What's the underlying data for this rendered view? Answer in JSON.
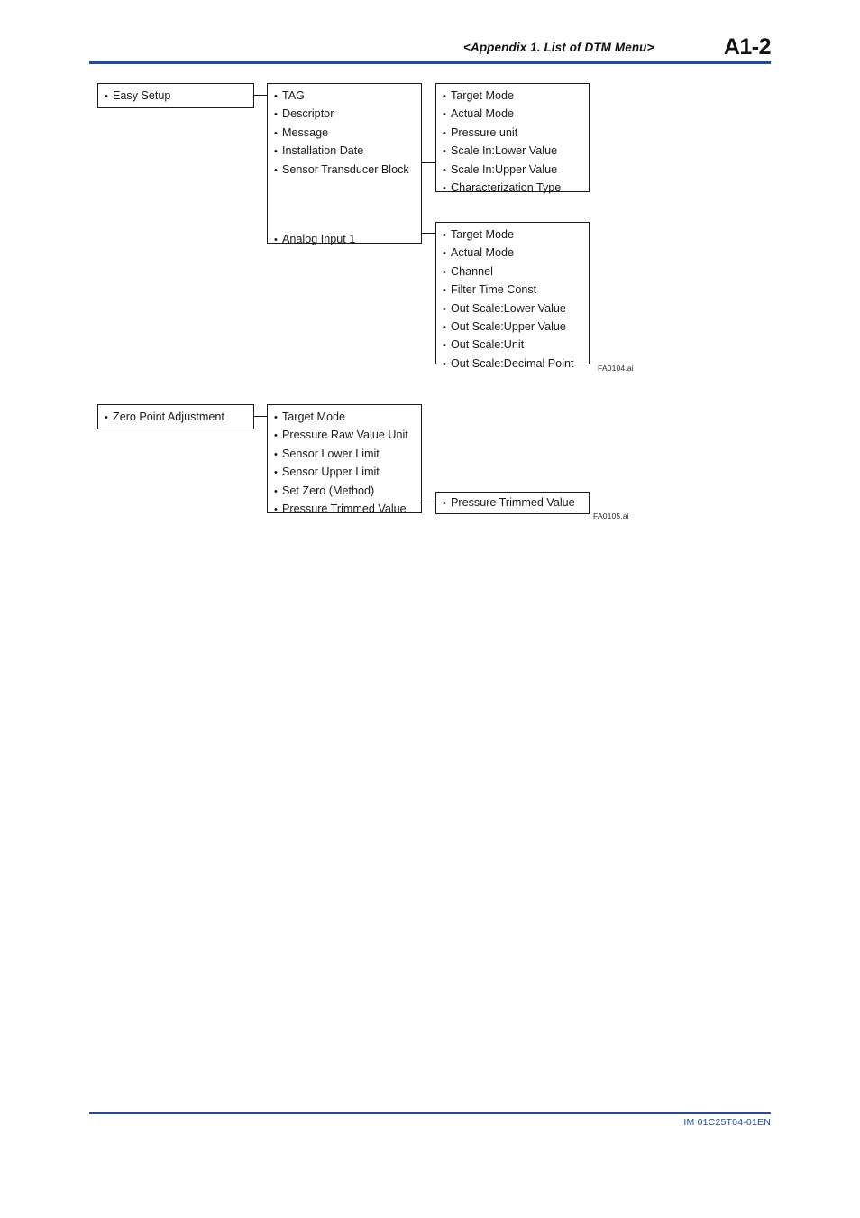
{
  "header": {
    "title": "<Appendix 1.  List of DTM Menu>",
    "page_number": "A1-2",
    "rule_color": "#1f4ba0"
  },
  "footer": {
    "document_code": "IM 01C25T04-01EN",
    "color": "#1f4ba0"
  },
  "diagrams": [
    {
      "id": "easy-setup",
      "caption": "FA0104.ai",
      "root": {
        "label": "Easy Setup"
      },
      "level2": {
        "items_top": [
          "TAG",
          "Descriptor",
          "Message",
          "Installation Date",
          "Sensor Transducer Block"
        ],
        "items_bottom": [
          "Analog Input 1"
        ]
      },
      "level3_sensor_transducer_block": [
        "Target Mode",
        "Actual Mode",
        "Pressure unit",
        "Scale In:Lower Value",
        "Scale In:Upper Value",
        "Characterization Type"
      ],
      "level3_analog_input": [
        "Target Mode",
        "Actual Mode",
        "Channel",
        "Filter Time Const",
        "Out Scale:Lower Value",
        "Out Scale:Upper Value",
        "Out Scale:Unit",
        "Out Scale:Decimal Point"
      ]
    },
    {
      "id": "zero-point-adjustment",
      "caption": "FA0105.ai",
      "root": {
        "label": "Zero Point Adjustment"
      },
      "level2": [
        "Target Mode",
        "Pressure Raw Value Unit",
        "Sensor Lower Limit",
        "Sensor Upper Limit",
        "Set Zero (Method)",
        "Pressure Trimmed Value"
      ],
      "level3": [
        "Pressure Trimmed Value"
      ]
    }
  ]
}
